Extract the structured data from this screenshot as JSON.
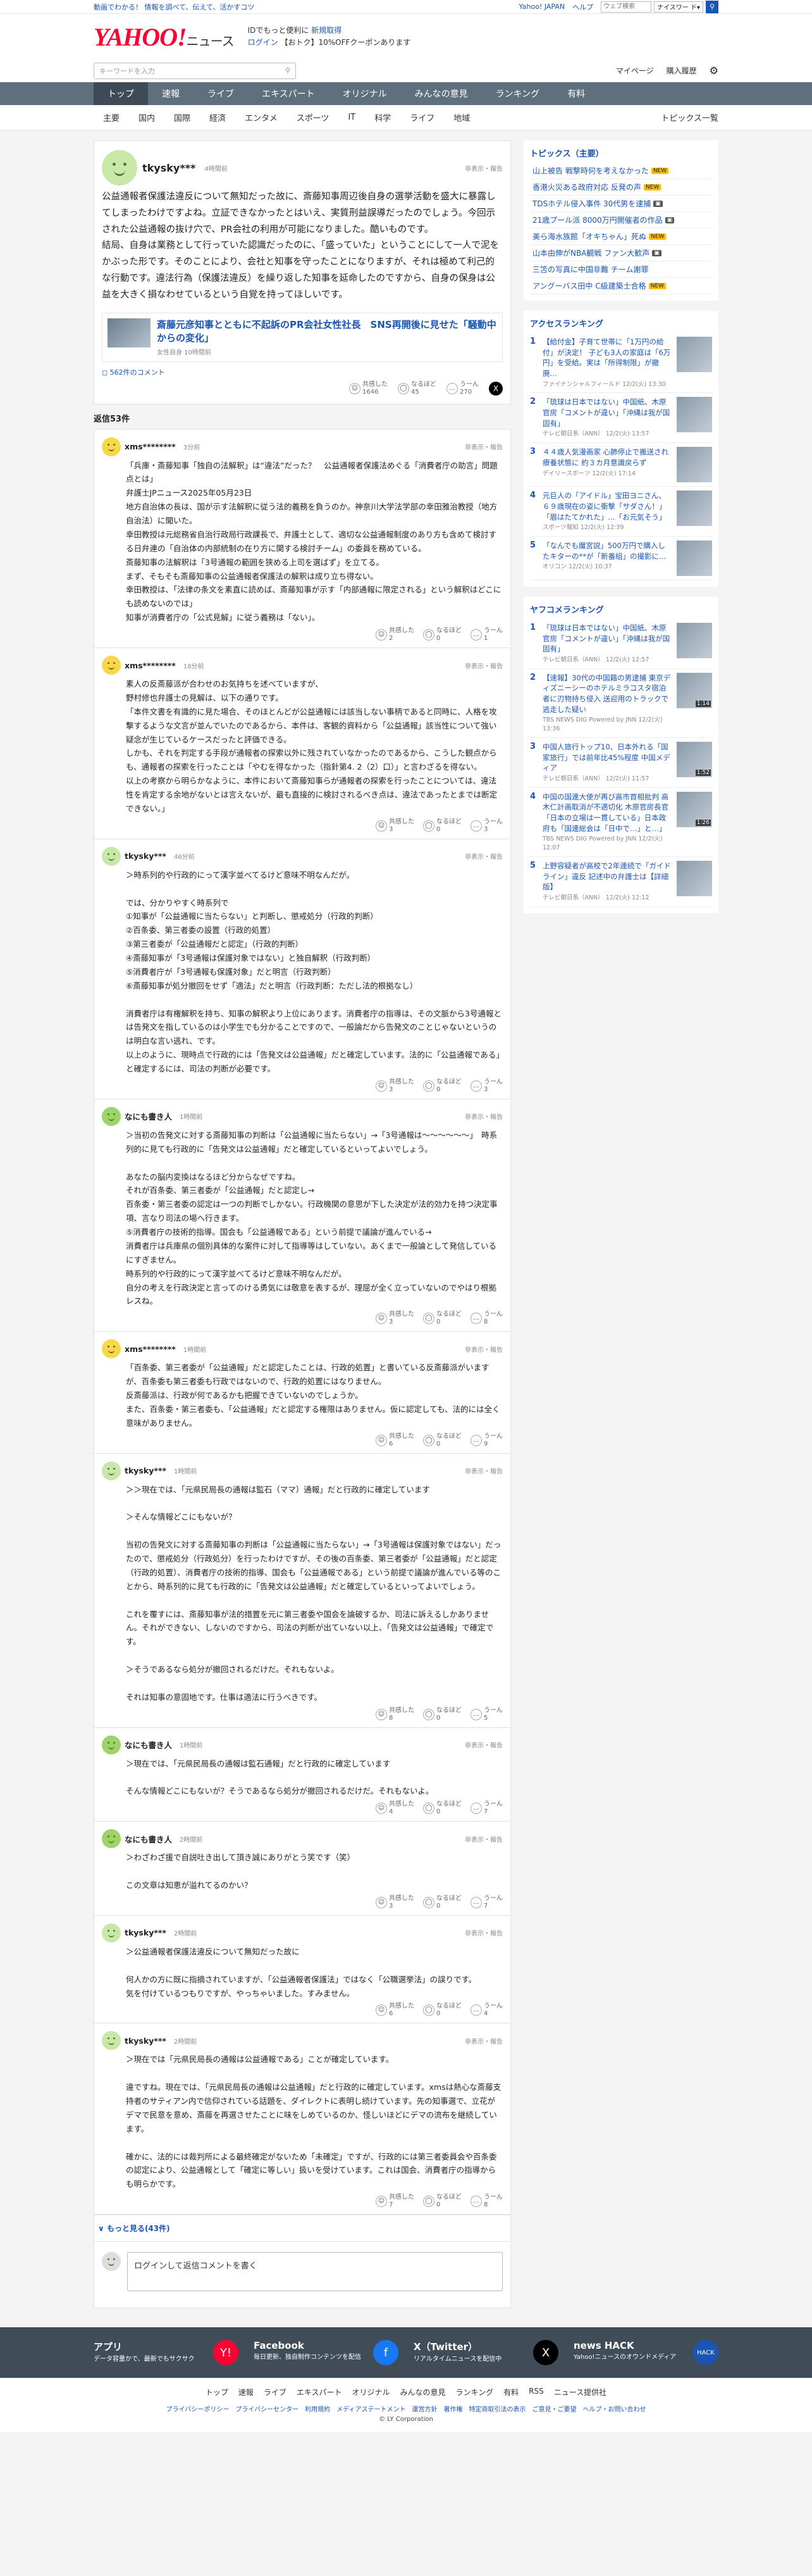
{
  "top_strip": {
    "left": "動画でわかる！ 情報を調べて、伝えて、活かすコツ",
    "yahoo_japan": "Yahoo! JAPAN",
    "help": "ヘルプ",
    "search_placeholder": "ウェブ検索",
    "search_type": "ナイスワー ド▾"
  },
  "header": {
    "logo": "YAHOO!",
    "logo_sub": "ニュース",
    "promo_l1_pre": "IDでもっと便利に",
    "promo_l1_link": "新規取得",
    "promo_l2_login": "ログイン",
    "promo_l2_rest": "【おトク】10%OFFクーポンあります"
  },
  "search_row": {
    "placeholder": "キーワードを入力",
    "mypage": "マイページ",
    "purchase": "購入履歴"
  },
  "nav": [
    "トップ",
    "速報",
    "ライブ",
    "エキスパート",
    "オリジナル",
    "みんなの意見",
    "ランキング",
    "有料"
  ],
  "subnav": [
    "主要",
    "国内",
    "国際",
    "経済",
    "エンタメ",
    "スポーツ",
    "IT",
    "科学",
    "ライフ",
    "地域"
  ],
  "subnav_trend": "トピックス一覧",
  "main_comment": {
    "user": "tkysky***",
    "time": "4時間前",
    "report": "非表示・報告",
    "body": "公益通報者保護法違反について無知だった故に、斎藤知事周辺後自身の選挙活動を盛大に暴露してしまったわけですよね。立証できなかったとはいえ、実質刑益誤導だったのでしょう。今回示された公益通報の抜け穴で、PR会社の利用が可能になりました。酷いものです。\n結局、自身は業務として行っていた認識だったのに、「盛っていた」ということにして一人で泥をかぶった形です。そのことにより、会社と知事を守ったことになりますが、それは極めて利己的な行動です。違法行為（保護法違反）を繰り返した知事を延命したのですから、自身の保身は公益を大きく損なわせているという自覚を持ってほしいです。",
    "article_title": "斎藤元彦知事とともに不起訴のPR会社女性社長　SNS再開後に見せた「騒動中からの変化」",
    "article_meta": "女性自身 10時間前",
    "comment_count": "562件のコメント",
    "reacts": {
      "empathize": "共感した",
      "empathize_n": "1646",
      "think": "なるほど",
      "think_n": "45",
      "hmm": "うーん",
      "hmm_n": "270"
    }
  },
  "reply_label": "返信53件",
  "replies": [
    {
      "user": "xms********",
      "time": "3分前",
      "body": "「兵庫・斎藤知事「独自の法解釈」は“違法”だった？　公益通報者保護法めぐる「消費者庁の助言」問題点とは」\n弁護士JPニュース2025年05月23日\n地方自治体の長は、国が示す法解釈に従う法的義務を負うのか。神奈川大学法学部の幸田雅治教授（地方自治法）に聞いた。\n幸田教授は元総務省自治行政局行政課長で、弁護士として、適切な公益通報制度のあり方も含めて検討する日弁連の「自治体の内部統制の在り方に関する検討チーム」の委員を務めている。\n斎藤知事の法解釈は「3号通報の範囲を狭める上司を選ばず」を立てる。\nまず、そもそも斎藤知事の公益通報者保護法の解釈は成り立ち得ない。\n幸田教授は、「法律の条文を素直に読めば、斎藤知事が示す「内部通報に限定される」という解釈はどこにも読めないのでは」\n知事が消費者庁の「公式見解」に従う義務は「ない」。",
      "e": "2",
      "t": "0",
      "h": "1"
    },
    {
      "user": "xms********",
      "time": "18分前",
      "body": "素人の反斎藤派が合わせのお気持ちを述べていますが、\n野村修也弁護士の見解は、以下の通りです。\n「本件文書を有識的に見た場合、そのほとんどが公益通報には該当しない事柄であると同時に、人格を攻撃するような文言が並んでいたのであるから、本件は、客観的資料から「公益通報」該当性について強い疑念が生じているケースだったと評価できる。\nしかも、それを判定する手段が通報者の探索以外に残されていなかったのであるから、こうした観点からも、通報者の探索を行ったことは「やむを得なかった（指針第4. 2（2）口）」と言わざるを得ない。\n以上の考察から明らかなように、本件において斎藤知事らが通報者の探索を行ったことについては、違法性を肯定する余地がないとは言えないが、最も直接的に検討されるべき点は、違法であったとまでは断定できない。」",
      "e": "3",
      "t": "0",
      "h": "3"
    },
    {
      "user": "tkysky***",
      "time": "46分前",
      "body": "＞時系列的や行政的にって漢字並べてるけど意味不明なんだが。\n\nでは、分かりやすく時系列で\n①知事が「公益通報に当たらない」と判断し、懲戒処分（行政的判断）\n②百条委、第三者委の設置（行政的処置）\n③第三者委が「公益通報だと認定」（行政的判断）\n④斎藤知事が「3号通報は保護対象ではない」と独自解釈（行政判断）\n⑤消費者庁が「3号通報も保護対象」だと明言（行政判断）\n⑥斎藤知事が処分撤回をせず「適法」だと明言（行政判断：ただし法的根拠なし）\n\n消費者庁は有権解釈を持ち、知事の解釈より上位にあります。消費者庁の指導は、その文脈から3号通報とは告発文を指しているのは小学生でも分かることですので、一般論だから告発文のことじゃないというのは明白な言い逃れ、です。\n以上のように、現時点で行政的には「告発文は公益通報」だと確定しています。法的に「公益通報である」と確定するには、司法の判断が必要です。",
      "e": "3",
      "t": "0",
      "h": "3"
    },
    {
      "user": "なにも書き人",
      "time": "1時間前",
      "body": "＞当初の告発文に対する斎藤知事の判断は「公益通報に当たらない」→「3号通報は〜〜〜〜〜〜」　時系列的に見ても行政的に「告発文は公益通報」だと確定しているといってよいでしょう。\n\nあなたの脳内変換はなるほど分からなぜですね。\nそれが百条委、第三者委が「公益通報」だと認定し→\n百条委・第三者委の認定は一つの判断でしかない。行政機関の意思が下した決定が法的効力を持つ決定事項、言なり司法の場へ行きます。\n⑤消費者庁の技術的指導。国会も「公益通報である」という前提で議論が進んでいる→\n消費者庁は兵庫県の個別具体的な案件に対して指導等はしていない。あくまで一般論として発信しているにすぎません。\n時系列的や行政的にって漢字並べてるけど意味不明なんだが。\n自分の考えを行政決定と言ってのける勇気には敬意を表するが、理屈が全く立っていないのでやはり根拠レスね。",
      "e": "3",
      "t": "0",
      "h": "8"
    },
    {
      "user": "xms********",
      "time": "1時間前",
      "body": "「百条委、第三者委が「公益通報」だと認定したことは、行政的処置」と書いている反斎藤派がいますが、百条委も第三者委も行政ではないので、行政的処置にはなりません。\n反斎藤派は、行政が何であるかも把握できていないのでしょうか。\nまた、百条委・第三者委も、「公益通報」だと認定する権限はありません。仮に認定しても、法的には全く意味がありません。",
      "e": "6",
      "t": "0",
      "h": "9"
    },
    {
      "user": "tkysky***",
      "time": "1時間前",
      "body": "＞＞現在では、「元県民局長の通報は監石（ママ）通報」だと行政的に確定しています\n\n＞そんな情報どこにもないが？\n\n当初の告発文に対する斎藤知事の判断は「公益通報に当たらない」→「3号通報は保護対象ではない」だったので、懲戒処分（行政処分）を行ったわけですが、その後の百条委、第三者委が「公益通報」だと認定（行政的処置）、消費者庁の技術的指導、国会も「公益通報である」という前提で議論が進んでいる等のことから、時系列的に見ても行政的に「告発文は公益通報」だと確定しているといってよいでしょう。\n\nこれを覆すには、斎藤知事が法的措置を元に第三者委や国会を論破するか、司法に訴えるしかありません。それができない、しないのですから、司法の判断が出ていない以上、「告発文は公益通報」で確定です。\n\n＞そうであるなら処分が撤回されるだけだ。それもないよ。\n\nそれは知事の意固地です。仕事は適法に行うべきです。",
      "e": "8",
      "t": "0",
      "h": "5"
    },
    {
      "user": "なにも書き人",
      "time": "1時間前",
      "body": "＞現在では、「元県民局長の通報は監石通報」だと行政的に確定しています\n\nそんな情報どこにもないが？そうであるなら処分が撤回されるだけだ。それもないよ。",
      "e": "4",
      "t": "0",
      "h": "7"
    },
    {
      "user": "なにも書き人",
      "time": "2時間前",
      "body": "＞わざわざ援で自説吐き出して頂き誠にありがとう笑です（笑）\n\nこの文章は知恵が溢れてるのかい？",
      "e": "3",
      "t": "0",
      "h": "7"
    },
    {
      "user": "tkysky***",
      "time": "2時間前",
      "body": "＞公益通報者保護法違反について無知だった故に\n\n何人かの方に既に指摘されていますが、「公益通報者保護法」ではなく「公職選挙法」の誤りです。\n気を付けているつもりですが、やっちゃいました。すみません。",
      "e": "6",
      "t": "0",
      "h": "4"
    },
    {
      "user": "tkysky***",
      "time": "2時間前",
      "body": "＞現在では「元県民局長の通報は公益通報である」ことが確定しています。\n\n違ですね。現在では、「元県民局長の通報は公益通報」だと行政的に確定しています。xmsは熱心な斎藤支持者のサティアン内で信仰されている話題を、ダイレクトに表明し続けています。先の知事選で、立花がデマで民意を意め、斎藤を再選させたことに味をしめているのか、怪しいほどにデマの流布を継続しています。\n\n確かに、法的には裁判所による最終確定がないため「未確定」ですが、行政的には第三者委員会や百条委の認定により、公益通報として「確定に等しい」扱いを受けています。これは国会、消費者庁の指導からも明らかです。",
      "e": "7",
      "t": "0",
      "h": "8"
    }
  ],
  "more_replies": "もっと見る(43件)",
  "reply_box": "ログインして返信コメントを書く",
  "react_labels": {
    "e": "共感した",
    "t": "なるほど",
    "h": "うーん"
  },
  "side": {
    "topics_title": "トピックス（主要）",
    "topics": [
      {
        "text": "山上被告 戦撃時何を考えなかった",
        "badge": "new"
      },
      {
        "text": "香港火災ある政府対応 反発の声",
        "badge": "new"
      },
      {
        "text": "TDSホテル侵入事件 30代男を逮捕",
        "badge": "img"
      },
      {
        "text": "21歳プール派 8000万円開催者の作品",
        "badge": "img"
      },
      {
        "text": "美ら海水族館「オキちゃん」死ぬ",
        "badge": "new"
      },
      {
        "text": "山本由伸がNBA観戦 ファン大歓声",
        "badge": "img"
      },
      {
        "text": "三笘の写真に中国非難 チーム謝罪",
        "badge": ""
      },
      {
        "text": "アングーバス田中 C級建築士合格",
        "badge": "new"
      }
    ],
    "access_title": "アクセスランキング",
    "access": [
      {
        "text": "【給付金】子育て世帯に「1万円の給付」が決定！ 子ども3人の家庭は「6万円」を受給。実は「所得制限」が撤廃…",
        "meta": "ファイナンシャルフィールド 12/2(火) 13:30",
        "dur": ""
      },
      {
        "text": "「琉球は日本ではない」中国紙、木原官房「コメントが違い」「沖縄は我が国固有」",
        "meta": "テレビ朝日系（ANN） 12/2(火) 13:57",
        "dur": ""
      },
      {
        "text": "４４歳人気漫画家 心肺停止で搬送され療養状態に 約３カ月意識戻らず",
        "meta": "デイリースポーツ 12/2(火) 17:14",
        "dur": ""
      },
      {
        "text": "元巨人の「アイドル」宝田ヨニさん、６９歳現在の姿に衝撃「サダさん！」「眉はたてかれた」…「お元気そう」",
        "meta": "スポーツ報知 12/2(火) 12:39",
        "dur": ""
      },
      {
        "text": "「なんでも魔宮説」500万円で購入したキターの**が「新番組」の撮影に...",
        "meta": "オリコン 12/2(火) 10:37",
        "dur": ""
      }
    ],
    "yafoo_title": "ヤフコメランキング",
    "yafoo": [
      {
        "text": "「琉球は日本ではない」中国紙、木原官房「コメントが違い」「沖縄は我が国固有」",
        "meta": "テレビ朝日系（ANN） 12/2(火) 12:57",
        "dur": ""
      },
      {
        "text": "【速報】30代の中国籍の男逮捕 東京ディズニーシーのホテルミラコスタ宿泊者に刃物持ち侵入 送迎用のトラックで逃走した疑い",
        "meta": "TBS NEWS DIG Powered by JNN 12/2(火) 13:36",
        "dur": "1:14"
      },
      {
        "text": "中国人旅行トップ10、日本外れる「国家旅行」では前年比45%程度 中国メディア",
        "meta": "テレビ朝日系（ANN） 12/2(火) 11:57",
        "dur": "1:52"
      },
      {
        "text": "中国の国連大使が再び高市首相批判 高木仁計画取消が不適切化 木原官房長官「日本の立場は一貫している」日本政府も「国連総会は「日中で…」と…」",
        "meta": "TBS NEWS DIG Powered by JNN 12/2(火) 12:07",
        "dur": "1:26"
      },
      {
        "text": "上野容疑者が高校で2年連続で「ガイドライン」違反 記述中の弁護士は【詳細版】",
        "meta": "テレビ朝日系（ANN） 12/2(火) 12:12",
        "dur": ""
      }
    ]
  },
  "footer_apps": [
    {
      "title": "アプリ",
      "desc": "データ容量かで、最新でもサクサク",
      "icon": "Y!",
      "color": "#ff0033"
    },
    {
      "title": "Facebook",
      "desc": "毎日更新、独自制作コンテンツを配信",
      "icon": "f",
      "color": "#1877f2"
    },
    {
      "title": "X（Twitter）",
      "desc": "リアルタイムニュースを配信中",
      "icon": "X",
      "color": "#000000"
    },
    {
      "title": "news HACK",
      "desc": "Yahoo!ニュースのオウンドメディア",
      "icon": "HACK",
      "color": "#1a55b4"
    }
  ],
  "footer_nav": [
    "トップ",
    "速報",
    "ライブ",
    "エキスパート",
    "オリジナル",
    "みんなの意見",
    "ランキング",
    "有料",
    "RSS",
    "ニュース提供社"
  ],
  "footer_links": [
    "プライバシーポリシー",
    "プライバシーセンター",
    "利用規約",
    "メディアステートメント",
    "運営方針",
    "著作権",
    "特定商取引法の表示",
    "ご意見・ご要望",
    "ヘルプ・お問い合わせ"
  ],
  "copyright": "© LY Corporation"
}
